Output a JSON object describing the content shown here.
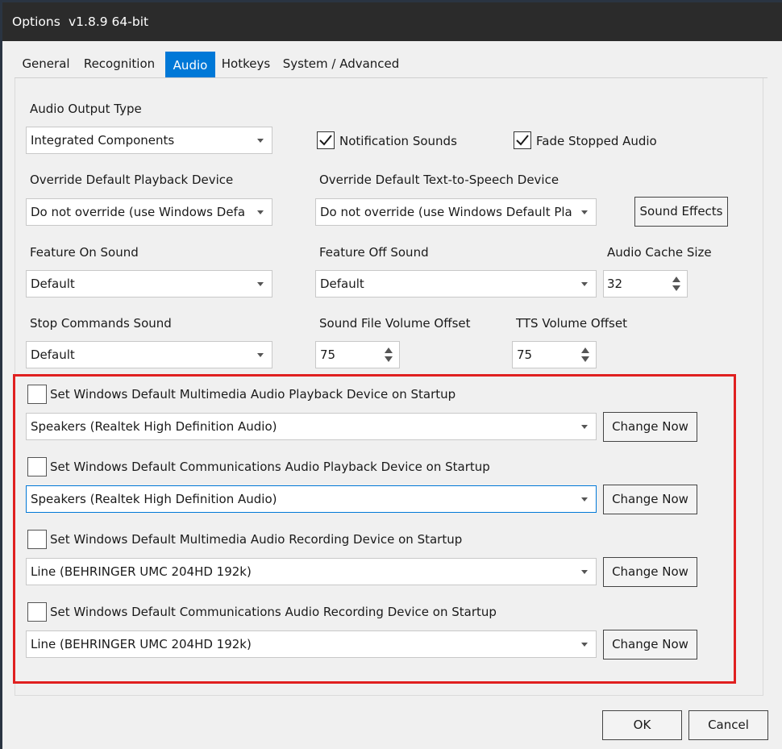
{
  "window": {
    "title": "Options",
    "version": "v1.8.9  64-bit"
  },
  "tabs": [
    {
      "label": "General",
      "active": false
    },
    {
      "label": "Recognition",
      "active": false
    },
    {
      "label": "Audio",
      "active": true
    },
    {
      "label": "Hotkeys",
      "active": false
    },
    {
      "label": "System / Advanced",
      "active": false
    }
  ],
  "audio": {
    "output_type": {
      "label": "Audio Output Type",
      "value": "Integrated Components"
    },
    "notification_sounds": {
      "label": "Notification Sounds",
      "checked": true
    },
    "fade_stopped_audio": {
      "label": "Fade Stopped Audio",
      "checked": true
    },
    "override_playback": {
      "label": "Override Default Playback Device",
      "value": "Do not override (use Windows Defa"
    },
    "override_tts": {
      "label": "Override  Default  Text-to-Speech  Device",
      "value": "Do not override (use Windows Default Pla"
    },
    "sound_effects_button": "Sound Effects",
    "feature_on_sound": {
      "label": "Feature On Sound",
      "value": "Default"
    },
    "feature_off_sound": {
      "label": "Feature Off Sound",
      "value": "Default"
    },
    "audio_cache_size": {
      "label": "Audio Cache Size",
      "value": "32"
    },
    "stop_commands_sound": {
      "label": "Stop Commands Sound",
      "value": "Default"
    },
    "sound_file_volume_offset": {
      "label": "Sound File Volume Offset",
      "value": "75"
    },
    "tts_volume_offset": {
      "label": "TTS Volume Offset",
      "value": "75"
    }
  },
  "startup_devices": [
    {
      "label": "Set  Windows  Default  Multimedia  Audio  Playback  Device  on  Startup",
      "checked": false,
      "device": "Speakers (Realtek High Definition Audio)",
      "button": "Change Now"
    },
    {
      "label": "Set  Windows  Default  Communications  Audio  Playback  Device  on  Startup",
      "checked": false,
      "device": "Speakers (Realtek High Definition Audio)",
      "button": "Change Now"
    },
    {
      "label": "Set  Windows  Default  Multimedia  Audio  Recording  Device  on  Startup",
      "checked": false,
      "device": "Line (BEHRINGER UMC 204HD 192k)",
      "button": "Change Now"
    },
    {
      "label": "Set  Windows  Default  Communications  Audio  Recording  Device  on  Startup",
      "checked": false,
      "device": "Line (BEHRINGER UMC 204HD 192k)",
      "button": "Change Now"
    }
  ],
  "footer": {
    "ok": "OK",
    "cancel": "Cancel"
  },
  "colors": {
    "accent": "#0078d7",
    "titlebar": "#2b2b2b",
    "highlight_box": "#e02020"
  }
}
